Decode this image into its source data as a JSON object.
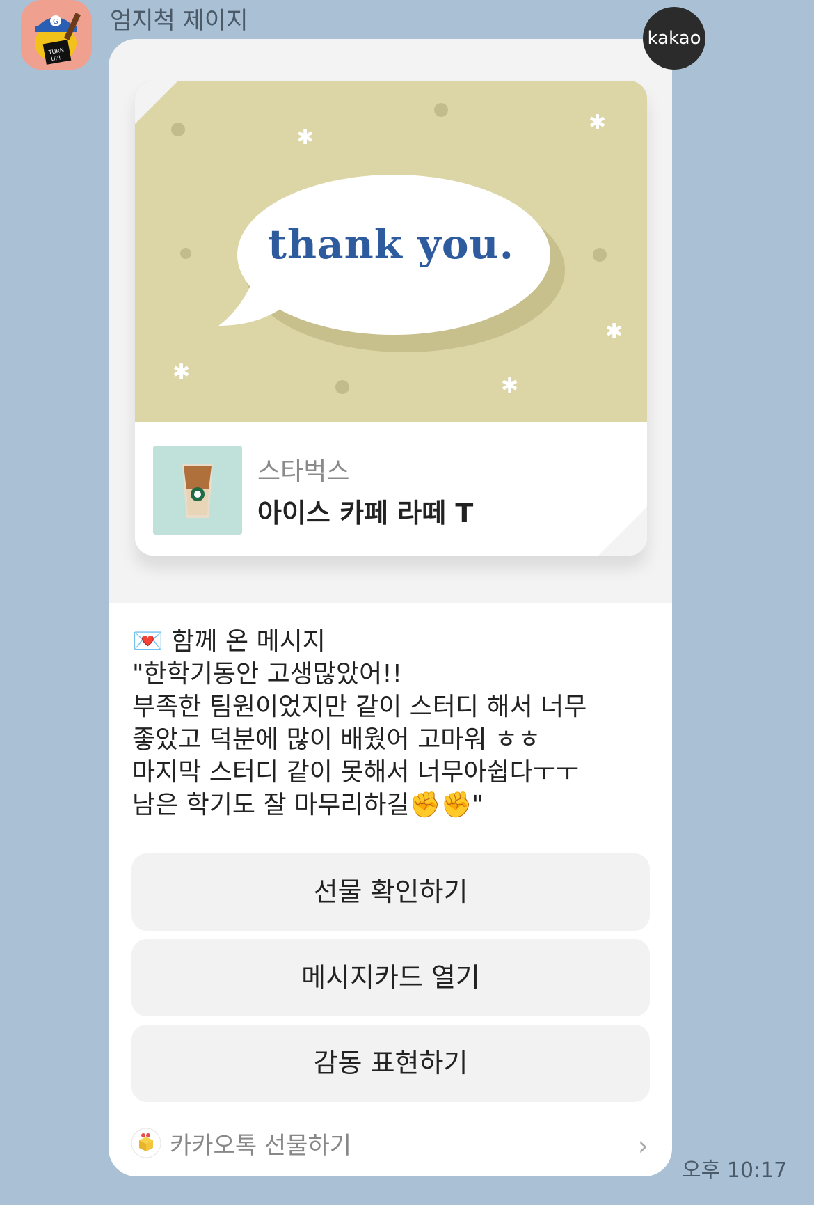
{
  "chat": {
    "sender_name": "엄지척 제이지",
    "time": "오후 10:17"
  },
  "badge": {
    "label": "kakao"
  },
  "card": {
    "headline": "thank you.",
    "brand": "스타벅스",
    "product": "아이스 카페 라떼 T"
  },
  "message": {
    "header": "💌 함께 온 메시지",
    "lines": [
      "\"한학기동안 고생많았어!!",
      "부족한 팀원이었지만 같이 스터디 해서 너무",
      "좋았고 덕분에 많이 배웠어 고마워 ㅎㅎ",
      "마지막 스터디 같이 못해서 너무아쉽다ㅜㅜ",
      "남은 학기도 잘 마무리하길✊✊\""
    ]
  },
  "buttons": {
    "confirm_gift": "선물 확인하기",
    "open_card": "메시지카드 열기",
    "express_thanks": "감동 표현하기"
  },
  "footer": {
    "label": "카카오톡 선물하기",
    "icon": "gift-box-icon",
    "chevron": "chevron-right-icon"
  },
  "colors": {
    "chat_background": "#a9c0d5",
    "card_art_background": "#dcd6a6",
    "headline": "#2d5b9e"
  }
}
